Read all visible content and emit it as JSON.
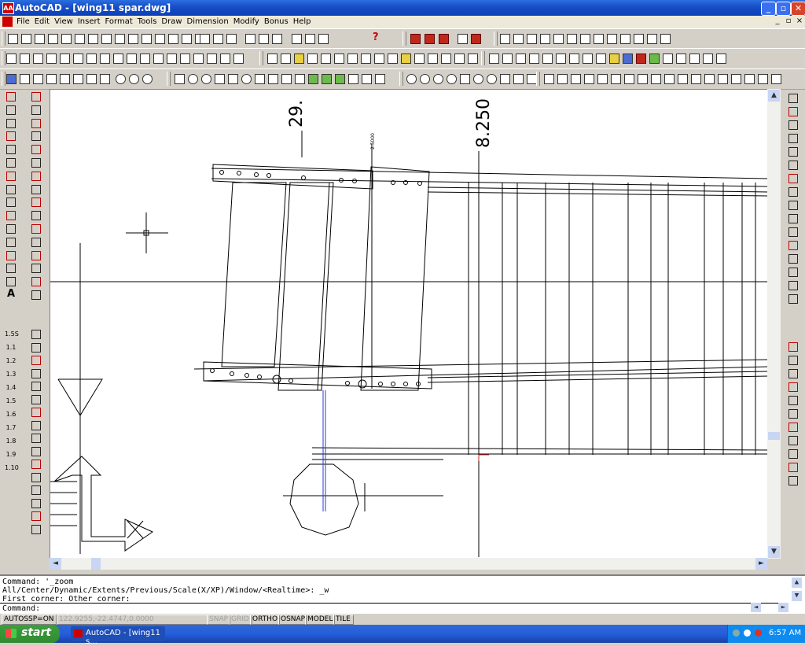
{
  "window": {
    "title": "AutoCAD - [wing11 spar.dwg]",
    "app_icon_text": "AA"
  },
  "menu": {
    "items": [
      "File",
      "Edit",
      "View",
      "Insert",
      "Format",
      "Tools",
      "Draw",
      "Dimension",
      "Modify",
      "Bonus",
      "Help"
    ]
  },
  "drawing": {
    "dim_label_1": "29.",
    "dim_label_2": "8.250",
    "dim_label_small": "2.5000",
    "layer_markers": [
      "1.5S",
      "1.1",
      "1.2",
      "1.3",
      "1.4",
      "1.5",
      "1.6",
      "1.7",
      "1.8",
      "1.9",
      "1.10"
    ]
  },
  "command": {
    "line1": "Command: '_zoom",
    "line2": "All/Center/Dynamic/Extents/Previous/Scale(X/XP)/Window/<Realtime>: _w",
    "line3": "First corner: Other corner:",
    "prompt": "Command:"
  },
  "status": {
    "autossp": "AUTOSSP=ON",
    "coords": "122.9255,-22.4747,0.0000",
    "toggles": [
      {
        "label": "SNAP",
        "on": false
      },
      {
        "label": "GRID",
        "on": false
      },
      {
        "label": "ORTHO",
        "on": true
      },
      {
        "label": "OSNAP",
        "on": true
      },
      {
        "label": "MODEL",
        "on": true
      },
      {
        "label": "TILE",
        "on": true
      }
    ]
  },
  "taskbar": {
    "start_label": "start",
    "task_label": "AutoCAD - [wing11 s...",
    "clock": "6:57 AM"
  }
}
